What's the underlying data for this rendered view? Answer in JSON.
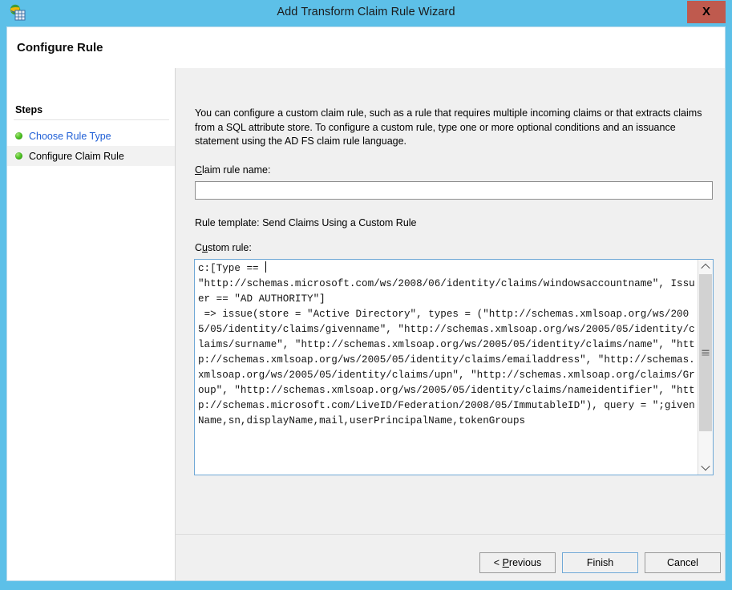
{
  "window": {
    "title": "Add Transform Claim Rule Wizard",
    "app_icon": "adfs-globe-window-icon",
    "close_label": "X",
    "frame_color": "#5dc0e8",
    "close_button_color": "#bf5a4e"
  },
  "header": {
    "page_title": "Configure Rule"
  },
  "sidebar": {
    "heading": "Steps",
    "items": [
      {
        "label": "Choose Rule Type",
        "state": "link",
        "bullet": "green-bullet-icon"
      },
      {
        "label": "Configure Claim Rule",
        "state": "current",
        "bullet": "green-bullet-icon"
      }
    ]
  },
  "main": {
    "intro_text": "You can configure a custom claim rule, such as a rule that requires multiple incoming claims or that extracts claims from a SQL attribute store. To configure a custom rule, type one or more optional conditions and an issuance statement using the AD FS claim rule language.",
    "claim_rule_name": {
      "label_accel": "C",
      "label_rest": "laim rule name:",
      "value": "",
      "placeholder": ""
    },
    "rule_template_text": "Rule template: Send Claims Using a Custom Rule",
    "custom_rule": {
      "label_accel_pre": "C",
      "label_accel": "u",
      "label_rest": "stom rule:",
      "text": "c:[Type == \n\"http://schemas.microsoft.com/ws/2008/06/identity/claims/windowsaccountname\", Issuer == \"AD AUTHORITY\"]\n => issue(store = \"Active Directory\", types = (\"http://schemas.xmlsoap.org/ws/2005/05/identity/claims/givenname\", \"http://schemas.xmlsoap.org/ws/2005/05/identity/claims/surname\", \"http://schemas.xmlsoap.org/ws/2005/05/identity/claims/name\", \"http://schemas.xmlsoap.org/ws/2005/05/identity/claims/emailaddress\", \"http://schemas.xmlsoap.org/ws/2005/05/identity/claims/upn\", \"http://schemas.xmlsoap.org/claims/Group\", \"http://schemas.xmlsoap.org/ws/2005/05/identity/claims/nameidentifier\", \"http://schemas.microsoft.com/LiveID/Federation/2008/05/ImmutableID\"), query = \";givenName,sn,displayName,mail,userPrincipalName,tokenGroups",
      "scroll_up_icon": "chevron-up-icon",
      "scroll_down_icon": "chevron-down-icon"
    }
  },
  "footer": {
    "previous_pre": "< ",
    "previous_accel": "P",
    "previous_rest": "revious",
    "finish_label": "Finish",
    "cancel_label": "Cancel"
  }
}
